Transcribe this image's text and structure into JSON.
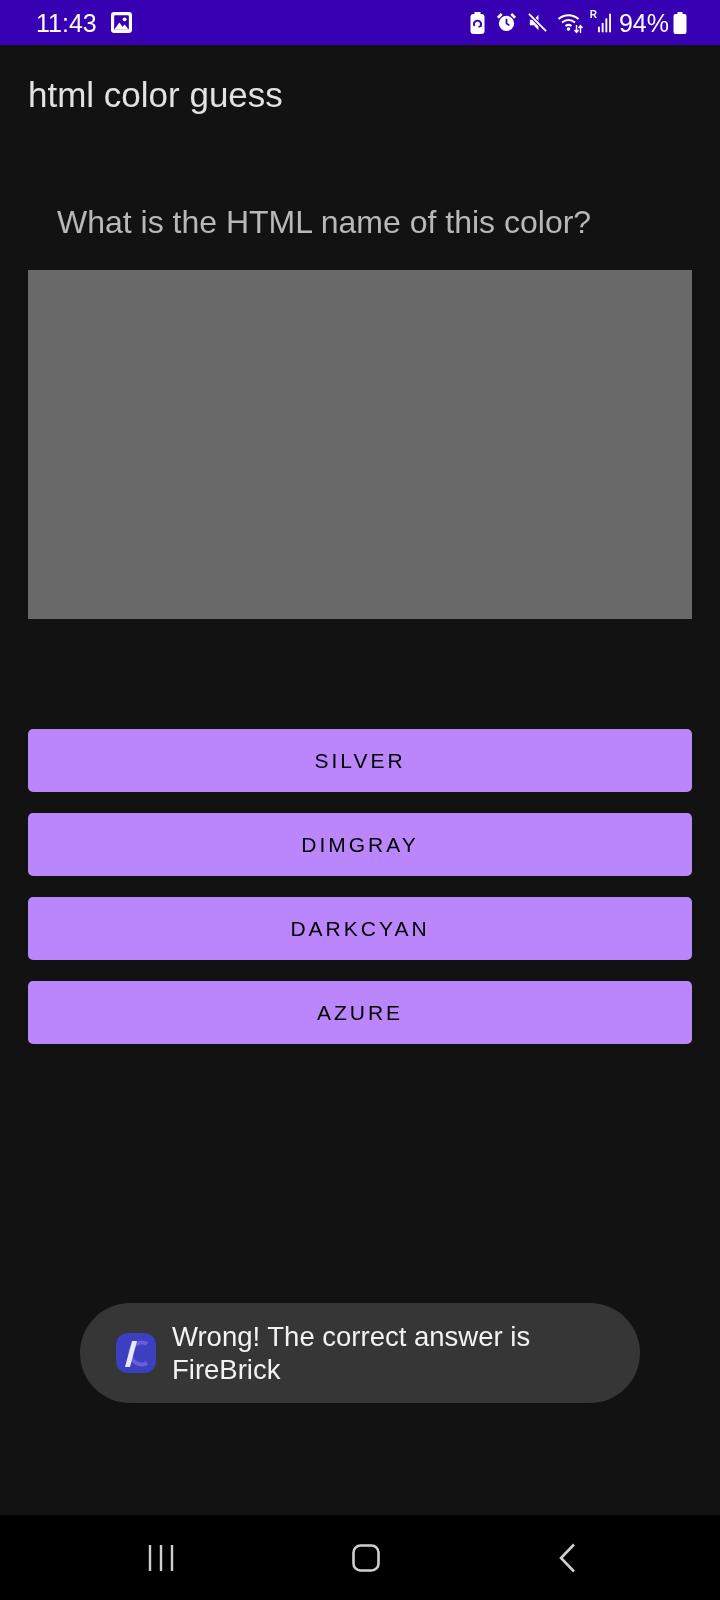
{
  "status_bar": {
    "time": "11:43",
    "roaming": "R",
    "battery": "94%"
  },
  "app_bar": {
    "title": "html color guess"
  },
  "question": "What is the HTML name of this color?",
  "swatch": {
    "color": "#696969"
  },
  "answers": [
    {
      "label": "SILVER"
    },
    {
      "label": "DIMGRAY"
    },
    {
      "label": "DARKCYAN"
    },
    {
      "label": "AZURE"
    }
  ],
  "toast": {
    "message": "Wrong! The correct answer is FireBrick"
  }
}
